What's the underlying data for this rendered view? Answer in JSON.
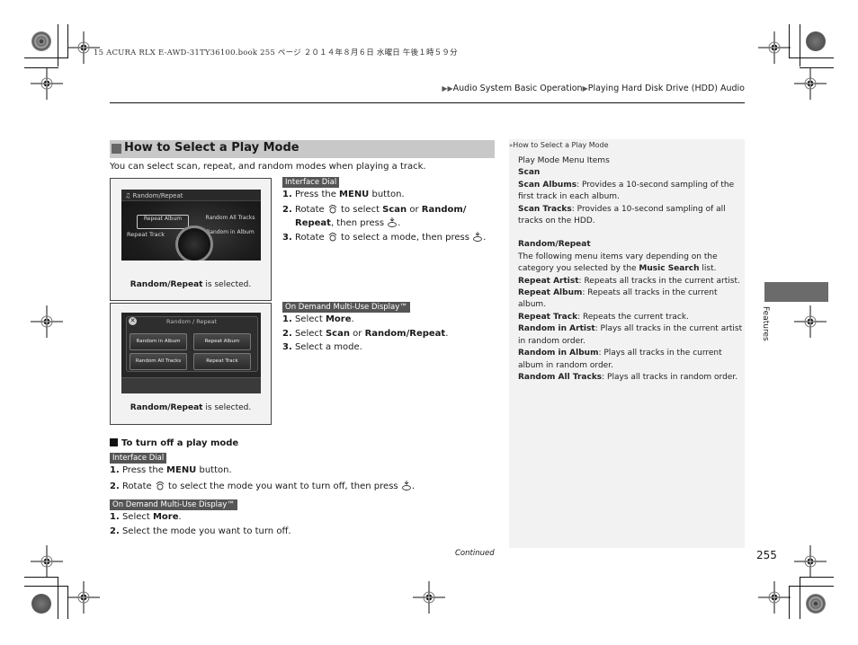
{
  "print_header": "15 ACURA RLX E-AWD-31TY36100.book  255 ページ  ２０１４年８月６日  水曜日  午後１時５９分",
  "breadcrumb": {
    "items": [
      "Audio System Basic Operation",
      "Playing Hard Disk Drive (HDD) Audio"
    ]
  },
  "section": {
    "title": "How to Select a Play Mode",
    "intro": "You can select scan, repeat, and random modes when playing a track."
  },
  "figure1": {
    "screen_title": "Random/Repeat",
    "items": [
      "Repeat Album",
      "Random All Tracks",
      "Repeat Track",
      "Random in Album"
    ],
    "caption_bold": "Random/Repeat",
    "caption_rest": " is selected."
  },
  "figure2": {
    "screen_title": "Random / Repeat",
    "buttons": [
      "Random in Album",
      "Repeat  Album",
      "Random All Tracks",
      "Repeat Track"
    ],
    "caption_bold": "Random/Repeat",
    "caption_rest": " is selected."
  },
  "interface_dial": {
    "tag": "Interface Dial",
    "steps": [
      {
        "num": "1.",
        "pre": " Press the ",
        "bold": "MENU",
        "post": " button."
      },
      {
        "num": "2.",
        "pre": " Rotate ",
        "mid": " to select ",
        "bold1": "Scan",
        "or": " or ",
        "bold2": "Random/",
        "bold3": "Repeat",
        "post": ", then press "
      },
      {
        "num": "3.",
        "pre": " Rotate ",
        "mid": " to select a mode, then press "
      }
    ]
  },
  "odmd": {
    "tag": "On Demand Multi-Use Display™",
    "steps": [
      {
        "num": "1.",
        "pre": " Select ",
        "bold": "More",
        "post": "."
      },
      {
        "num": "2.",
        "pre": " Select ",
        "bold1": "Scan",
        "or": " or ",
        "bold2": "Random/Repeat",
        "post": "."
      },
      {
        "num": "3.",
        "pre": " Select a mode."
      }
    ]
  },
  "turn_off": {
    "heading": "To turn off a play mode",
    "dial_tag": "Interface Dial",
    "dial_steps": [
      {
        "num": "1.",
        "pre": " Press the ",
        "bold": "MENU",
        "post": " button."
      },
      {
        "num": "2.",
        "pre": " Rotate ",
        "post": " to select the mode you want to turn off, then press "
      }
    ],
    "odmd_tag": "On Demand Multi-Use Display™",
    "odmd_steps": [
      {
        "num": "1.",
        "pre": " Select ",
        "bold": "More",
        "post": "."
      },
      {
        "num": "2.",
        "pre": " Select the mode you want to turn off."
      }
    ]
  },
  "sidebar": {
    "title": "How to Select a Play Mode",
    "heading": "Play Mode Menu Items",
    "scan_heading": "Scan",
    "scan_albums_label": "Scan Albums",
    "scan_albums_text": ": Provides a 10-second sampling of the first track in each album.",
    "scan_tracks_label": "Scan Tracks",
    "scan_tracks_text": ": Provides a 10-second sampling of all tracks on the HDD.",
    "rr_heading": "Random/Repeat",
    "rr_intro_pre": "The following menu items vary depending on the category you selected by the ",
    "rr_intro_bold": "Music Search",
    "rr_intro_post": " list.",
    "entries": [
      {
        "label": "Repeat Artist",
        "text": ": Repeats all tracks in the current artist."
      },
      {
        "label": "Repeat Album",
        "text": ": Repeats all tracks in the current album."
      },
      {
        "label": "Repeat Track",
        "text": ": Repeats the current track."
      },
      {
        "label": "Random in Artist",
        "text": ": Plays all tracks in the current artist in random order."
      },
      {
        "label": "Random in Album",
        "text": ": Plays all tracks in the current album in random order."
      },
      {
        "label": "Random All Tracks",
        "text": ": Plays all tracks in random order."
      }
    ]
  },
  "footer": {
    "continued": "Continued",
    "page_number": "255"
  },
  "side_tab": {
    "label": "Features",
    "color": "#6b6b6b"
  },
  "icons": {
    "breadcrumb": "double-right-triangle-icon",
    "dial": "interface-dial-rotate-icon",
    "press": "interface-dial-press-icon"
  }
}
